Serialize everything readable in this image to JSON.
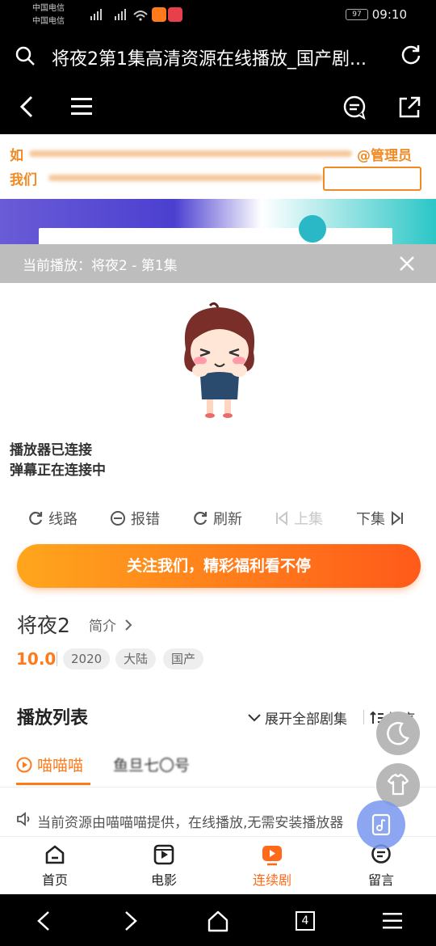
{
  "status_bar": {
    "carrier1": "中国电信",
    "carrier2": "中国电信",
    "battery": "97",
    "time": "09:10"
  },
  "url_bar": {
    "title": "将夜2第1集高清资源在线播放_国产剧..."
  },
  "banner": {
    "line1_left": "如",
    "line1_right": "@管理员",
    "line2_left": "我们"
  },
  "now_playing": {
    "text": "当前播放：将夜2 - 第1集"
  },
  "player": {
    "status1": "播放器已连接",
    "status2": "弹幕正在连接中"
  },
  "controls": {
    "route": "线路",
    "report": "报错",
    "refresh": "刷新",
    "prev": "上集",
    "next": "下集"
  },
  "follow_button": "关注我们，精彩福利看不停",
  "show": {
    "name": "将夜2",
    "intro_label": "简介",
    "score": "10.0",
    "tags": [
      "2020",
      "大陆",
      "国产"
    ]
  },
  "playlist": {
    "heading": "播放列表",
    "expand_all": "展开全部剧集",
    "sort": "排序",
    "source_active": "喵喵喵",
    "source_other": "鱼旦七〇号",
    "notice": "当前资源由喵喵喵提供，在线播放,无需安装播放器"
  },
  "tab_bar": [
    {
      "label": "首页",
      "icon": "home-icon"
    },
    {
      "label": "电影",
      "icon": "film-icon"
    },
    {
      "label": "连续剧",
      "icon": "tv-play-icon"
    },
    {
      "label": "留言",
      "icon": "message-icon"
    }
  ],
  "system_nav": {
    "tabs_count": "4"
  },
  "colors": {
    "accent": "#ff7a1a",
    "follow_gradient_start": "#ffa61c",
    "follow_gradient_end": "#ff5a1a",
    "now_playing_bg": "#bdbdbd"
  }
}
